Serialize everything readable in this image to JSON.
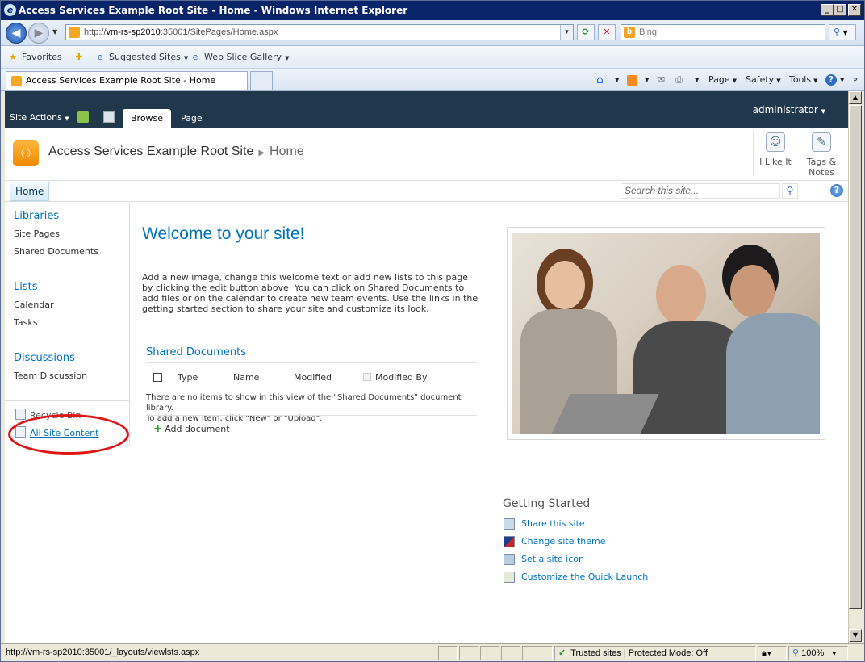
{
  "window": {
    "title": "Access Services Example Root Site - Home - Windows Internet Explorer",
    "min": "_",
    "max": "□",
    "close": "✕"
  },
  "addressbar": {
    "url_prefix": "http://",
    "url_host": "vm-rs-sp2010",
    "url_rest": ":35001/SitePages/Home.aspx",
    "search_placeholder": "Bing"
  },
  "favorites": {
    "favorites_label": "Favorites",
    "suggested_sites": "Suggested Sites",
    "web_slice_gallery": "Web Slice Gallery"
  },
  "tabs": {
    "active_tab": "Access Services Example Root Site - Home"
  },
  "commandbar": {
    "page": "Page",
    "safety": "Safety",
    "tools": "Tools"
  },
  "ribbon": {
    "site_actions": "Site Actions",
    "tab_browse": "Browse",
    "tab_page": "Page",
    "user": "administrator"
  },
  "siteheader": {
    "site_title": "Access Services Example Root Site",
    "breadcrumb_current": "Home",
    "i_like_it": "I Like It",
    "tags_notes_line1": "Tags &",
    "tags_notes_line2": "Notes"
  },
  "topnav": {
    "home": "Home",
    "search_placeholder": "Search this site..."
  },
  "quicklaunch": {
    "libraries": "Libraries",
    "site_pages": "Site Pages",
    "shared_documents": "Shared Documents",
    "lists": "Lists",
    "calendar": "Calendar",
    "tasks": "Tasks",
    "discussions": "Discussions",
    "team_discussion": "Team Discussion",
    "recycle_bin": "Recycle Bin",
    "all_site_content": "All Site Content"
  },
  "main": {
    "welcome": "Welcome to your site!",
    "intro": "Add a new image, change this welcome text or add new lists to this page by clicking the edit button above. You can click on Shared Documents to add files or on the calendar to create new team events. Use the links in the getting started section to share your site and customize its look."
  },
  "shared_docs": {
    "title": "Shared Documents",
    "col_type": "Type",
    "col_name": "Name",
    "col_modified": "Modified",
    "col_modified_by": "Modified By",
    "empty_line1": "There are no items to show in this view of the \"Shared Documents\" document library.",
    "empty_line2": "To add a new item, click \"New\" or \"Upload\".",
    "add_document": "Add document"
  },
  "getting_started": {
    "title": "Getting Started",
    "share": "Share this site",
    "theme": "Change site theme",
    "icon": "Set a site icon",
    "quicklaunch": "Customize the Quick Launch"
  },
  "statusbar": {
    "url": "http://vm-rs-sp2010:35001/_layouts/viewlsts.aspx",
    "zone": "Trusted sites | Protected Mode: Off",
    "zoom": "100%"
  },
  "colors": {
    "ribbon_bg": "#21374c",
    "link_blue": "#0072bc",
    "annotation_red": "#e01616"
  }
}
